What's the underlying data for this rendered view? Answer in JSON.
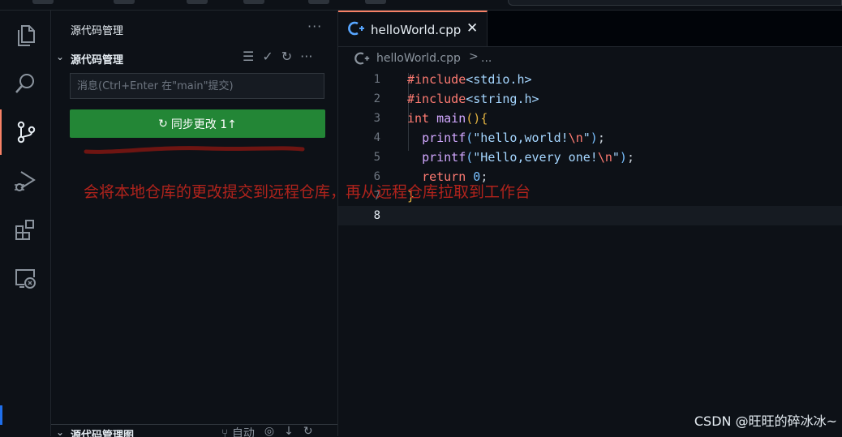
{
  "sidebar": {
    "title": "源代码管理",
    "more": "···",
    "section": {
      "label": "源代码管理",
      "tools": [
        "☰",
        "✓",
        "↻",
        "···"
      ]
    },
    "message_placeholder": "消息(Ctrl+Enter 在\"main\"提交)",
    "sync_button": {
      "icon": "↻",
      "label": "同步更改 1↑"
    },
    "bottom_section": {
      "label": "源代码管理图",
      "tools": [
        "⑂ 自动",
        "◎",
        "↓",
        "↻"
      ]
    }
  },
  "activity_bar": [
    "explorer-icon",
    "search-icon",
    "source-control-icon",
    "run-debug-icon",
    "extensions-icon",
    "remote-explorer-icon"
  ],
  "annotation": {
    "text": "会将本地仓库的更改提交到远程仓库，再从远程仓库拉取到工作台",
    "color": "#b0231c"
  },
  "editor": {
    "tab": {
      "name": "helloWorld.cpp",
      "close": "✕"
    },
    "breadcrumb": {
      "file": "helloWorld.cpp",
      "separator": ">",
      "more": "..."
    },
    "lines": [
      {
        "num": "1",
        "code": "#include<stdio.h>"
      },
      {
        "num": "2",
        "code": "#include<string.h>"
      },
      {
        "num": "3",
        "code": "int main(){"
      },
      {
        "num": "4",
        "code": "  printf(\"hello,world!\\n\");"
      },
      {
        "num": "5",
        "code": "  printf(\"Hello,every one!\\n\");"
      },
      {
        "num": "6",
        "code": "  return 0;"
      },
      {
        "num": "7",
        "code": "}"
      },
      {
        "num": "8",
        "code": ""
      }
    ]
  },
  "watermark": "CSDN @旺旺的碎冰冰~",
  "colors": {
    "background": "#0d1117",
    "sync_button": "#238636",
    "active_tab_accent": "#f78166",
    "keyword": "#ff7b72",
    "function": "#d2a8ff",
    "string": "#a5d6ff"
  }
}
